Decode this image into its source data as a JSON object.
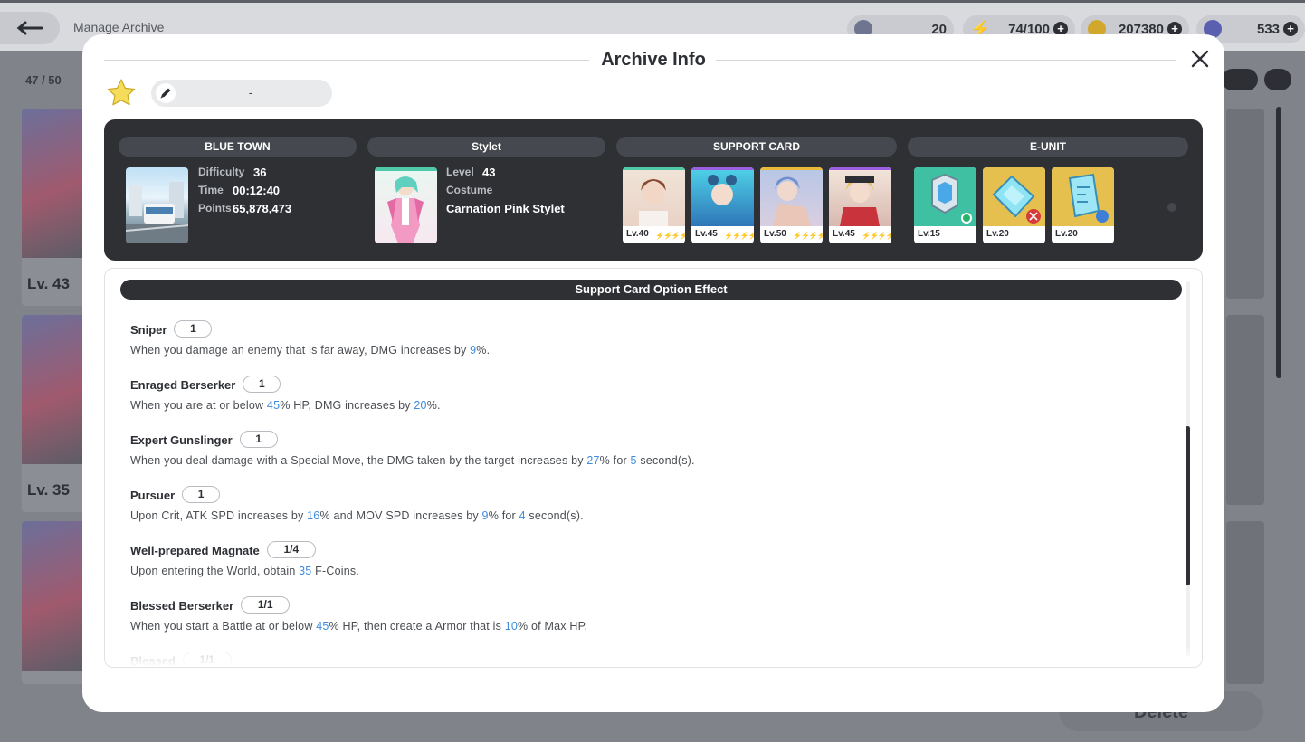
{
  "background": {
    "title": "Manage Archive",
    "resources": [
      {
        "name": "rank",
        "value": "20",
        "icon": "rank-icon"
      },
      {
        "name": "stamina",
        "value": "74/100",
        "icon": "lightning-icon"
      },
      {
        "name": "gold",
        "value": "207380",
        "icon": "coin-icon"
      },
      {
        "name": "gems",
        "value": "533",
        "icon": "gem-icon"
      }
    ],
    "archive_count": "47 / 50",
    "cards": [
      {
        "level": "Lv. 43"
      },
      {
        "level": "Lv. 35"
      }
    ],
    "delete_label": "Delete"
  },
  "modal": {
    "title": "Archive Info",
    "archive_name": "-",
    "stage": {
      "header": "BLUE TOWN",
      "difficulty_label": "Difficulty",
      "difficulty": "36",
      "time_label": "Time",
      "time": "00:12:40",
      "points_label": "Points",
      "points": "65,878,473"
    },
    "stylet": {
      "header": "Stylet",
      "level_label": "Level",
      "level": "43",
      "costume_label": "Costume",
      "costume": "Carnation Pink Stylet"
    },
    "support_card": {
      "header": "SUPPORT CARD",
      "cards": [
        {
          "level": "Lv.40",
          "bolts": "⚡⚡⚡⚡",
          "bolt_color": "#c9ccd2"
        },
        {
          "level": "Lv.45",
          "bolts": "⚡⚡⚡⚡",
          "bolt_color": "#b57be0"
        },
        {
          "level": "Lv.50",
          "bolts": "⚡⚡⚡⚡",
          "bolt_color": "#e8b93a"
        },
        {
          "level": "Lv.45",
          "bolts": "⚡⚡⚡⚡",
          "bolt_color": "#b57be0"
        }
      ]
    },
    "e_unit": {
      "header": "E-UNIT",
      "units": [
        {
          "level": "Lv.15"
        },
        {
          "level": "Lv.20"
        },
        {
          "level": "Lv.20"
        }
      ]
    },
    "options": {
      "header": "Support Card Option Effect",
      "items": [
        {
          "name": "Sniper",
          "count": "1",
          "desc": [
            [
              "When you damage an enemy that is far away, DMG increases by ",
              false
            ],
            [
              "9",
              true
            ],
            [
              "%.",
              false
            ]
          ]
        },
        {
          "name": "Enraged Berserker",
          "count": "1",
          "desc": [
            [
              "When you are at or below ",
              false
            ],
            [
              "45",
              true
            ],
            [
              "% HP, DMG increases by ",
              false
            ],
            [
              "20",
              true
            ],
            [
              "%.",
              false
            ]
          ]
        },
        {
          "name": "Expert Gunslinger",
          "count": "1",
          "desc": [
            [
              "When you deal damage with a Special Move, the DMG taken by the target increases by ",
              false
            ],
            [
              "27",
              true
            ],
            [
              "% for ",
              false
            ],
            [
              "5",
              true
            ],
            [
              " second(s).",
              false
            ]
          ]
        },
        {
          "name": "Pursuer",
          "count": "1",
          "desc": [
            [
              "Upon Crit, ATK SPD increases by ",
              false
            ],
            [
              "16",
              true
            ],
            [
              "% and MOV SPD increases by ",
              false
            ],
            [
              "9",
              true
            ],
            [
              "% for ",
              false
            ],
            [
              "4",
              true
            ],
            [
              " second(s).",
              false
            ]
          ]
        },
        {
          "name": "Well-prepared Magnate",
          "count": "1/4",
          "desc": [
            [
              "Upon entering the World, obtain ",
              false
            ],
            [
              "35",
              true
            ],
            [
              " F-Coins.",
              false
            ]
          ]
        },
        {
          "name": "Blessed Berserker",
          "count": "1/1",
          "desc": [
            [
              "When you start a Battle at or below ",
              false
            ],
            [
              "45",
              true
            ],
            [
              "% HP, then create a Armor that is ",
              false
            ],
            [
              "10",
              true
            ],
            [
              "% of Max HP.",
              false
            ]
          ]
        },
        {
          "name": "Blessed",
          "count": "1/1",
          "desc": []
        }
      ]
    }
  }
}
